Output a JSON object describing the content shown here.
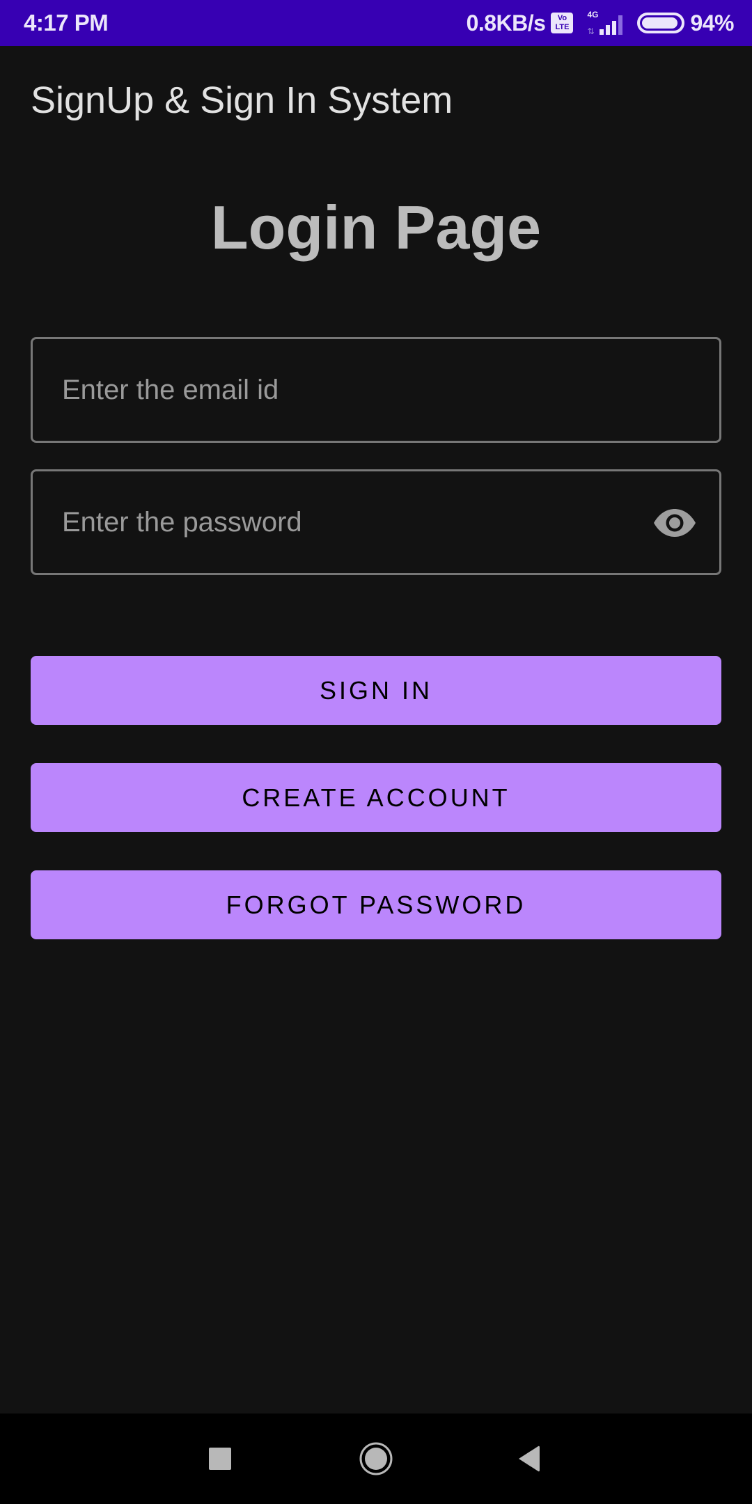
{
  "status_bar": {
    "time": "4:17 PM",
    "net_speed": "0.8KB/s",
    "volte_top": "Vo",
    "volte_bottom": "LTE",
    "network_type": "4G",
    "battery_percent": "94%",
    "battery_level": 0.94,
    "signal_icon": "signal-bars-icon",
    "battery_icon": "battery-icon"
  },
  "app_bar": {
    "title": "SignUp & Sign In System"
  },
  "main": {
    "page_title": "Login Page",
    "email_field": {
      "value": "",
      "placeholder": "Enter the email id"
    },
    "password_field": {
      "value": "",
      "placeholder": "Enter the password",
      "toggle_icon": "eye-icon"
    },
    "buttons": {
      "sign_in": "SIGN IN",
      "create_account": "CREATE ACCOUNT",
      "forgot_password": "FORGOT PASSWORD"
    }
  },
  "nav_bar": {
    "recents_icon": "square-recents-icon",
    "home_icon": "circle-home-icon",
    "back_icon": "triangle-back-icon"
  },
  "colors": {
    "status_bar": "#3700b3",
    "background": "#121212",
    "button": "#bb86fc",
    "button_text": "#000000",
    "field_border": "#777777",
    "placeholder": "#9a9a9a",
    "title_text": "#bcbcbc",
    "app_title_text": "#e2e2e2"
  }
}
